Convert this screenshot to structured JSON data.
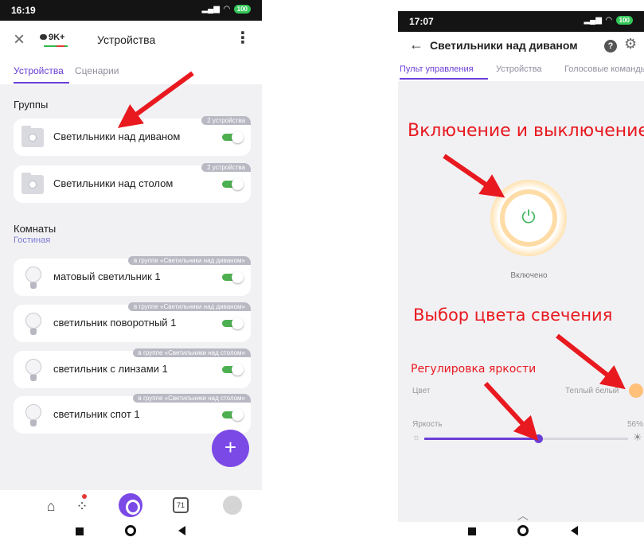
{
  "left_screen": {
    "status": {
      "time": "16:19",
      "signal_icon": "signal-icon",
      "wifi_icon": "wifi-icon",
      "battery": "100"
    },
    "header": {
      "close_icon": "close-icon",
      "pill_text": "9K+",
      "title": "Устройства",
      "more_icon": "more-vertical-icon"
    },
    "tabs": [
      {
        "label": "Устройства",
        "active": true
      },
      {
        "label": "Сценарии",
        "active": false
      }
    ],
    "groups": {
      "title": "Группы",
      "items": [
        {
          "name": "Светильники над диваном",
          "tag": "2 устройства",
          "on": true
        },
        {
          "name": "Светильники над столом",
          "tag": "2 устройства",
          "on": true
        }
      ]
    },
    "rooms": {
      "title": "Комнаты",
      "room_name": "Гостиная",
      "items": [
        {
          "name": "матовый светильник 1",
          "tag": "в группе «Светильники над диваном»",
          "on": true
        },
        {
          "name": "светильник поворотный 1",
          "tag": "в группе «Светильники над диваном»",
          "on": true
        },
        {
          "name": "светильник с линзами 1",
          "tag": "в группе «Светильники над столом»",
          "on": true
        },
        {
          "name": "светильник спот 1",
          "tag": "в группе «Светильники над столом»",
          "on": true
        }
      ]
    },
    "fab_label": "+",
    "bottom_nav": {
      "home_icon": "home-icon",
      "devices_icon": "devices-icon",
      "alice_icon": "alice-icon",
      "calendar_value": "71",
      "profile_icon": "avatar-icon"
    }
  },
  "right_screen": {
    "status": {
      "time": "17:07",
      "battery": "100"
    },
    "header": {
      "back_icon": "arrow-left-icon",
      "title": "Светильники над диваном",
      "help_label": "?",
      "settings_icon": "gear-icon"
    },
    "tabs": [
      {
        "label": "Пульт управления",
        "active": true
      },
      {
        "label": "Устройства",
        "active": false
      },
      {
        "label": "Голосовые команды",
        "active": false
      }
    ],
    "power": {
      "icon": "power-icon",
      "glyph": "⏻",
      "state_label": "Включено"
    },
    "color": {
      "label": "Цвет",
      "value": "Теплый белый",
      "swatch": "#ffc07a"
    },
    "brightness": {
      "label": "Яркость",
      "value_text": "56%",
      "value": 0.56
    }
  },
  "annotations": {
    "power": "Включение и выключение",
    "color": "Выбор цвета свечения",
    "brightness": "Регулировка яркости"
  },
  "colors": {
    "accent": "#6a3fd6",
    "toggle_on": "#4caf50",
    "arrow": "#e8191f",
    "fab": "#7b49e6"
  }
}
